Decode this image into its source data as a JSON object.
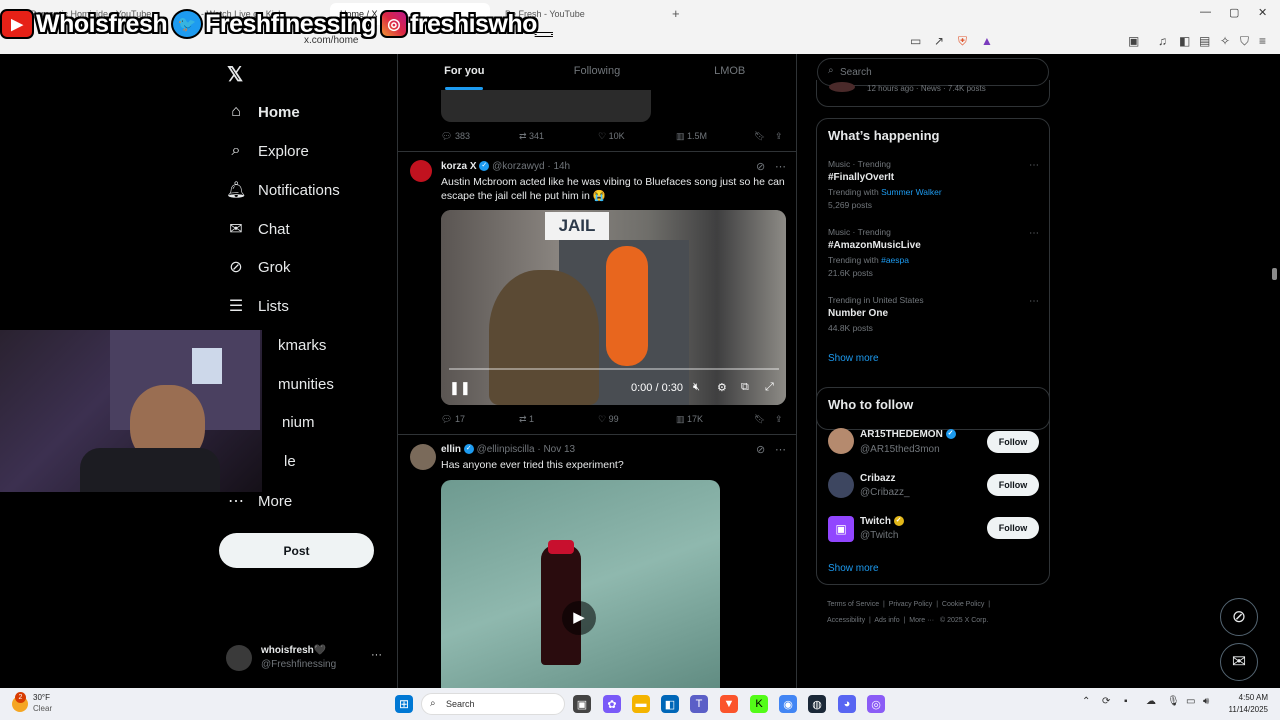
{
  "browser": {
    "tabs": [
      {
        "label": "Romantic Homicide - YouTube"
      },
      {
        "label": "S... - Watch Live on Kick"
      },
      {
        "label": "Home / X"
      },
      {
        "label": "Be Fresh - YouTube"
      }
    ],
    "url": "x.com/home",
    "new_tab": "+"
  },
  "overlay": {
    "youtube": "Whoisfresh",
    "twitter": "Freshfinessing",
    "instagram": "freshiswho_"
  },
  "nav": {
    "items": [
      {
        "label": "Home",
        "icon": "house-icon"
      },
      {
        "label": "Explore",
        "icon": "search-icon"
      },
      {
        "label": "Notifications",
        "icon": "bell-icon"
      },
      {
        "label": "Chat",
        "icon": "mail-icon"
      },
      {
        "label": "Grok",
        "icon": "grok-icon"
      },
      {
        "label": "Lists",
        "icon": "list-icon"
      },
      {
        "label": "kmarks"
      },
      {
        "label": "munities"
      },
      {
        "label": "nium"
      },
      {
        "label": "le"
      },
      {
        "label": "More",
        "icon": "more-icon"
      }
    ],
    "post": "Post",
    "profile": {
      "name": "whoisfresh🖤",
      "handle": "@Freshfinessing",
      "dots": "···"
    }
  },
  "feed": {
    "tabs": [
      "For you",
      "Following",
      "LMOB"
    ],
    "prev_actions": {
      "replies": "383",
      "reposts": "341",
      "likes": "10K",
      "views": "1.5M"
    },
    "tweet1": {
      "name": "korza X",
      "handle": "@korzawyd",
      "time": "14h",
      "text": "Austin Mcbroom acted like he was vibing to Bluefaces song just so he can escape the jail cell he put him in 😭",
      "video_sign": "JAIL",
      "video_time": "0:00 / 0:30",
      "replies": "17",
      "reposts": "1",
      "likes": "99",
      "views": "17K"
    },
    "tweet2": {
      "name": "ellin",
      "handle": "@ellinpiscilla",
      "time": "Nov 13",
      "text": "Has anyone ever tried this experiment?"
    }
  },
  "right": {
    "search_placeholder": "Search",
    "top_meta": "12 hours ago · News · 7.4K posts",
    "whats_happening": "What’s happening",
    "trends": [
      {
        "meta": "Music · Trending",
        "name": "#FinallyOverIt",
        "with_label": "Trending with",
        "with": "Summer Walker",
        "posts": "5,269 posts"
      },
      {
        "meta": "Music · Trending",
        "name": "#AmazonMusicLive",
        "with_label": "Trending with",
        "with": "#aespa",
        "posts": "21.6K posts"
      },
      {
        "meta": "Trending in United States",
        "name": "Number One",
        "posts": "44.8K posts"
      }
    ],
    "show_more": "Show more",
    "who_to_follow": "Who to follow",
    "follows": [
      {
        "name": "AR15THEDEMON",
        "handle": "@AR15thed3mon",
        "btn": "Follow"
      },
      {
        "name": "Cribazz",
        "handle": "@Cribazz_",
        "btn": "Follow"
      },
      {
        "name": "Twitch",
        "handle": "@Twitch",
        "btn": "Follow"
      }
    ],
    "show_more2": "Show more",
    "footer": [
      "Terms of Service",
      "Privacy Policy",
      "Cookie Policy",
      "Accessibility",
      "Ads info",
      "More ···",
      "© 2025 X Corp."
    ]
  },
  "taskbar": {
    "weather_temp": "30°F",
    "weather_desc": "Clear",
    "weather_badge": "2",
    "search": "Search",
    "time": "4:50 AM",
    "date": "11/14/2025"
  },
  "colors": {
    "accent": "#1d9bf0",
    "bg": "#000000",
    "text": "#e7e9ea",
    "muted": "#71767b"
  }
}
